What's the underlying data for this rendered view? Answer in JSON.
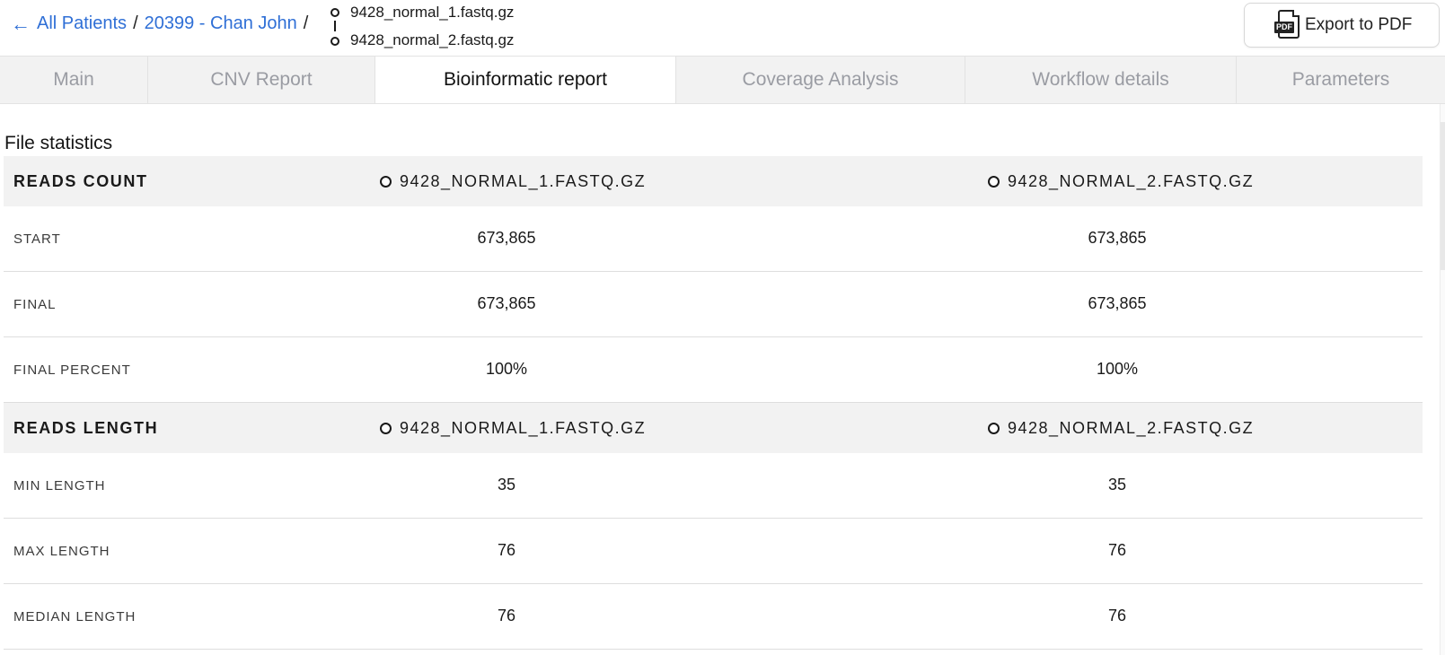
{
  "breadcrumb": {
    "all_patients": "All Patients",
    "separator": "/",
    "patient": "20399 - Chan John"
  },
  "files": {
    "file1": "9428_normal_1.fastq.gz",
    "file2": "9428_normal_2.fastq.gz"
  },
  "export": {
    "icon_text": "PDF",
    "label": "Export to PDF"
  },
  "tabs": [
    {
      "label": "Main",
      "active": false
    },
    {
      "label": "CNV Report",
      "active": false
    },
    {
      "label": "Bioinformatic report",
      "active": true
    },
    {
      "label": "Coverage Analysis",
      "active": false
    },
    {
      "label": "Workflow details",
      "active": false
    },
    {
      "label": "Parameters",
      "active": false
    }
  ],
  "section_title": "File statistics",
  "groups": [
    {
      "label": "READS COUNT",
      "col1": "9428_NORMAL_1.FASTQ.GZ",
      "col2": "9428_NORMAL_2.FASTQ.GZ",
      "rows": [
        {
          "label": "START",
          "v1": "673,865",
          "v2": "673,865"
        },
        {
          "label": "FINAL",
          "v1": "673,865",
          "v2": "673,865"
        },
        {
          "label": "FINAL PERCENT",
          "v1": "100%",
          "v2": "100%"
        }
      ]
    },
    {
      "label": "READS LENGTH",
      "col1": "9428_NORMAL_1.FASTQ.GZ",
      "col2": "9428_NORMAL_2.FASTQ.GZ",
      "rows": [
        {
          "label": "MIN LENGTH",
          "v1": "35",
          "v2": "35"
        },
        {
          "label": "MAX LENGTH",
          "v1": "76",
          "v2": "76"
        },
        {
          "label": "MEDIAN LENGTH",
          "v1": "76",
          "v2": "76"
        }
      ]
    }
  ],
  "colors": {
    "link": "#2f6fd6",
    "tab_bg": "#f2f2f2",
    "tab_inactive_text": "#9a9ca3",
    "group_header_bg": "#f2f2f2"
  }
}
